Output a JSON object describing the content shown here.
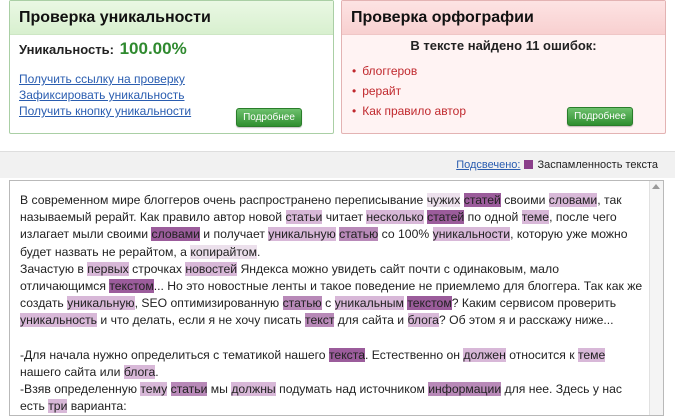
{
  "uniqueness": {
    "title": "Проверка уникальности",
    "label": "Уникальность:",
    "value": "100.00%",
    "links": [
      "Получить ссылку на проверку",
      "Зафиксировать уникальность",
      "Получить кнопку уникальности"
    ],
    "more_button": "Подробнее"
  },
  "spelling": {
    "title": "Проверка орфографии",
    "found_text": "В тексте найдено 11 ошибок:",
    "errors": [
      "блоггеров",
      "рерайт",
      "Как правило автор"
    ],
    "more_button": "Подробнее"
  },
  "legend": {
    "highlighted_label": "Подсвечено:",
    "item": "Заспамленность текста"
  },
  "colors": {
    "swatch": "#8b3f8b",
    "uniq_value": "#2f8a2f",
    "error_text": "#c0282d",
    "link": "#2a5db0"
  }
}
